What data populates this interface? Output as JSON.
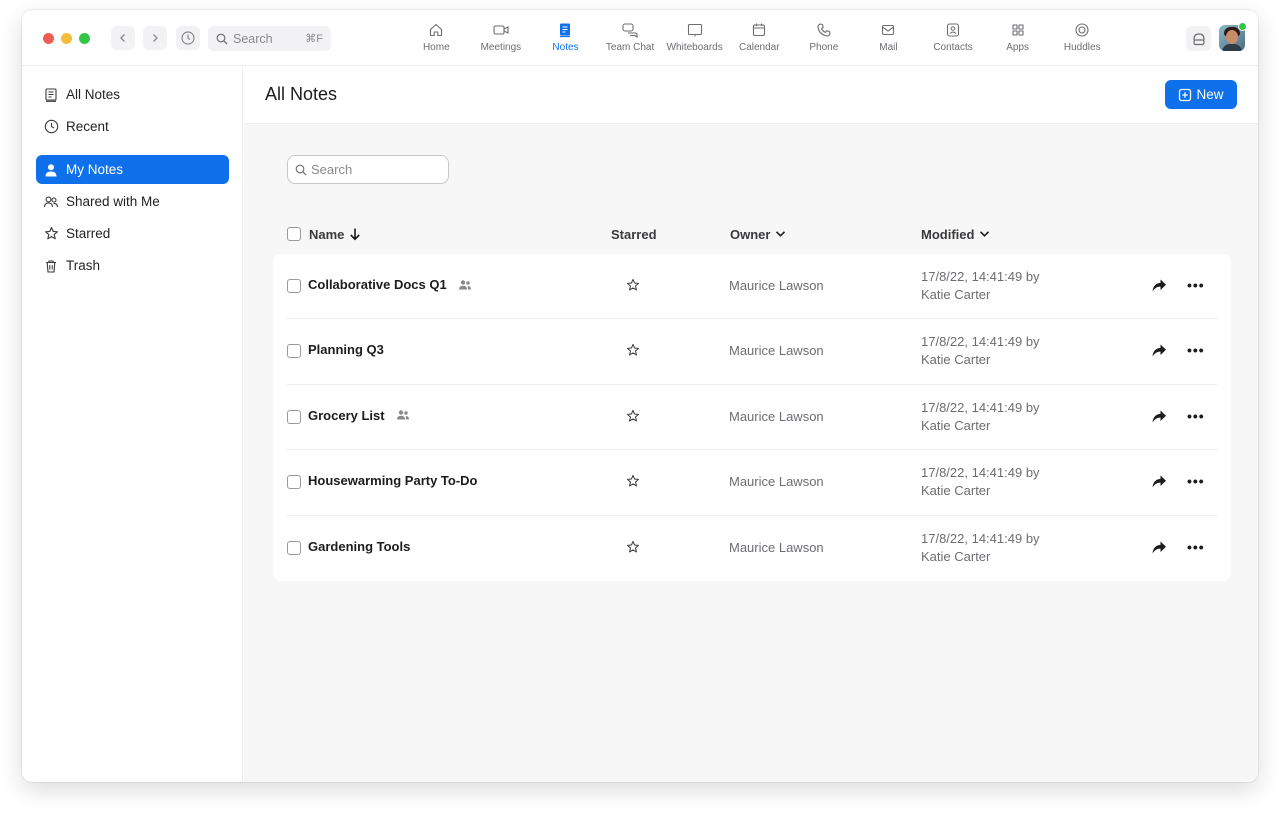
{
  "topbar": {
    "search_label": "Search",
    "search_shortcut": "⌘F",
    "tabs": [
      {
        "label": "Home",
        "icon": "home-icon"
      },
      {
        "label": "Meetings",
        "icon": "video-icon"
      },
      {
        "label": "Notes",
        "icon": "notes-icon",
        "active": true
      },
      {
        "label": "Team Chat",
        "icon": "chat-icon"
      },
      {
        "label": "Whiteboards",
        "icon": "whiteboard-icon"
      },
      {
        "label": "Calendar",
        "icon": "calendar-icon"
      },
      {
        "label": "Phone",
        "icon": "phone-icon"
      },
      {
        "label": "Mail",
        "icon": "mail-icon"
      },
      {
        "label": "Contacts",
        "icon": "contacts-icon"
      },
      {
        "label": "Apps",
        "icon": "apps-icon"
      },
      {
        "label": "Huddles",
        "icon": "huddles-icon"
      }
    ]
  },
  "sidebar": {
    "items": [
      {
        "label": "All Notes",
        "icon": "notes-list-icon"
      },
      {
        "label": "Recent",
        "icon": "clock-icon"
      },
      {
        "label": "My Notes",
        "icon": "person-icon",
        "active": true
      },
      {
        "label": "Shared with Me",
        "icon": "people-icon"
      },
      {
        "label": "Starred",
        "icon": "star-icon"
      },
      {
        "label": "Trash",
        "icon": "trash-icon"
      }
    ]
  },
  "main": {
    "title": "All Notes",
    "new_button": "New",
    "search_placeholder": "Search",
    "columns": {
      "name": "Name",
      "starred": "Starred",
      "owner": "Owner",
      "modified": "Modified"
    },
    "rows": [
      {
        "name": "Collaborative Docs Q1",
        "shared": true,
        "owner": "Maurice Lawson",
        "modified_line1": "17/8/22, 14:41:49 by",
        "modified_line2": "Katie Carter"
      },
      {
        "name": "Planning Q3",
        "shared": false,
        "owner": "Maurice Lawson",
        "modified_line1": "17/8/22, 14:41:49 by",
        "modified_line2": "Katie Carter"
      },
      {
        "name": "Grocery List",
        "shared": true,
        "owner": "Maurice Lawson",
        "modified_line1": "17/8/22, 14:41:49 by",
        "modified_line2": "Katie Carter"
      },
      {
        "name": "Housewarming Party To-Do",
        "shared": false,
        "owner": "Maurice Lawson",
        "modified_line1": "17/8/22, 14:41:49 by",
        "modified_line2": "Katie Carter"
      },
      {
        "name": "Gardening Tools",
        "shared": false,
        "owner": "Maurice Lawson",
        "modified_line1": "17/8/22, 14:41:49 by",
        "modified_line2": "Katie Carter"
      }
    ]
  },
  "colors": {
    "accent": "#0e71eb",
    "presence": "#2fc83e"
  }
}
